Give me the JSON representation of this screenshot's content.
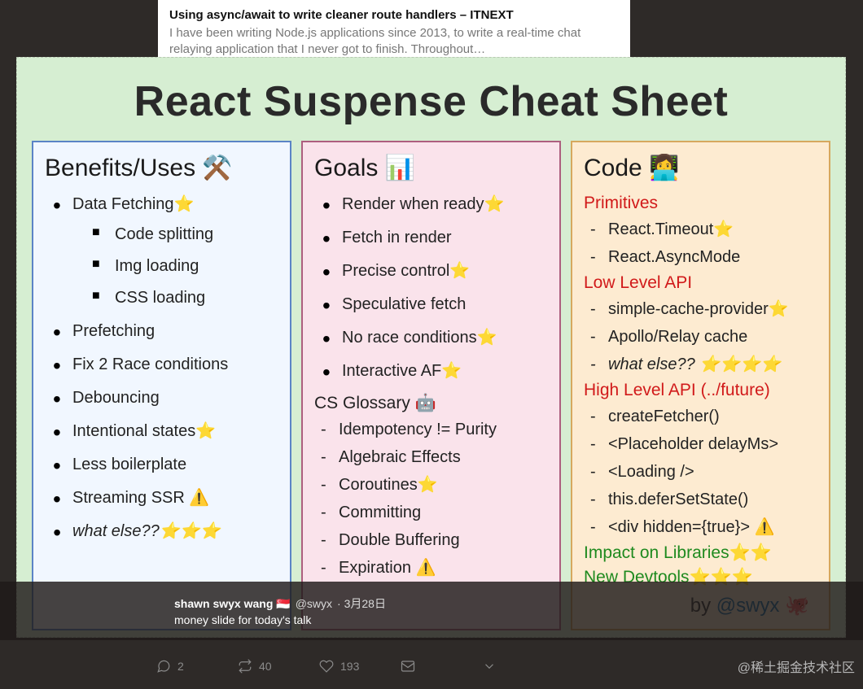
{
  "bg_article": {
    "title": "Using async/await to write cleaner route handlers – ITNEXT",
    "desc": "I have been writing Node.js applications since 2013, to write a real-time chat relaying application that I never got to finish. Throughout…"
  },
  "slide": {
    "title": "React Suspense Cheat Sheet",
    "benefits": {
      "heading": "Benefits/Uses ⚒️",
      "items": [
        {
          "text": "Data Fetching⭐",
          "sub": [
            "Code splitting",
            "Img loading",
            "CSS loading"
          ]
        },
        {
          "text": "Prefetching"
        },
        {
          "text": "Fix 2 Race conditions"
        },
        {
          "text": "Debouncing"
        },
        {
          "text": "Intentional states⭐"
        },
        {
          "text": "Less boilerplate"
        },
        {
          "text": "Streaming SSR ⚠️"
        },
        {
          "text": "what else??⭐⭐⭐",
          "italic": true
        }
      ]
    },
    "goals": {
      "heading": "Goals 📊",
      "items": [
        "Render when ready⭐",
        "Fetch in render",
        "Precise control⭐",
        "Speculative fetch",
        "No race conditions⭐",
        "Interactive AF⭐"
      ],
      "glossary_heading": "CS Glossary 🤖",
      "glossary": [
        "Idempotency != Purity",
        "Algebraic Effects",
        "Coroutines⭐",
        "Committing",
        "Double Buffering",
        "Expiration ⚠️"
      ]
    },
    "code": {
      "heading": "Code 👩‍💻",
      "primitives_label": "Primitives",
      "primitives": [
        "React.Timeout⭐",
        "React.AsyncMode"
      ],
      "lowlevel_label": "Low Level API",
      "lowlevel": [
        {
          "text": "simple-cache-provider⭐"
        },
        {
          "text": "Apollo/Relay cache"
        },
        {
          "text": "what else?? ⭐⭐⭐⭐",
          "italic": true
        }
      ],
      "highlevel_label": "High Level API (../future)",
      "highlevel": [
        "createFetcher()",
        "<Placeholder delayMs>",
        "<Loading />",
        "this.deferSetState()",
        "<div hidden={true}> ⚠️"
      ],
      "impact_label": "Impact on Libraries⭐⭐",
      "devtools_label": "New Devtools⭐⭐⭐"
    },
    "signoff_prefix": "by ",
    "signoff_handle": "@swyx",
    "signoff_suffix": " 🐙"
  },
  "tweet": {
    "name": "shawn swyx wang 🇸🇬",
    "handle": "@swyx",
    "date": "· 3月28日",
    "text": "money slide for today's talk"
  },
  "actions": {
    "reply_count": "2",
    "retweet_count": "40",
    "like_count": "193"
  },
  "watermark": "@稀土掘金技术社区"
}
